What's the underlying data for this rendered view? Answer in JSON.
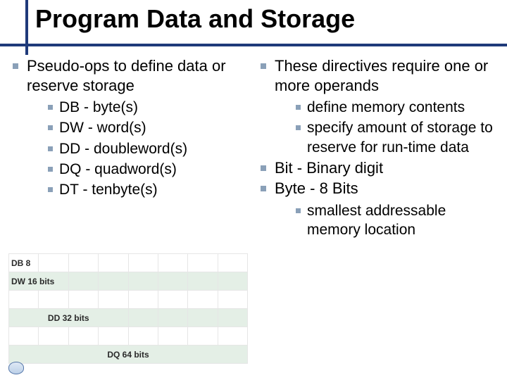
{
  "title": "Program Data and Storage",
  "left_col": {
    "main": "Pseudo-ops to define data or reserve storage",
    "subs": [
      "DB - byte(s)",
      "DW - word(s)",
      "DD - doubleword(s)",
      "DQ - quadword(s)",
      "DT - tenbyte(s)"
    ]
  },
  "right_col": {
    "items": [
      {
        "text": "These directives require one or more operands",
        "subs": [
          "define memory contents",
          "specify amount of storage to reserve for run-time data"
        ]
      },
      {
        "text": "Bit - Binary digit",
        "subs": []
      },
      {
        "text": "Byte - 8 Bits",
        "subs": [
          "smallest addressable memory location"
        ]
      }
    ]
  },
  "bits": {
    "db": "DB 8",
    "dw": "DW 16 bits",
    "dd": "DD 32 bits",
    "dq": "DQ 64 bits"
  }
}
